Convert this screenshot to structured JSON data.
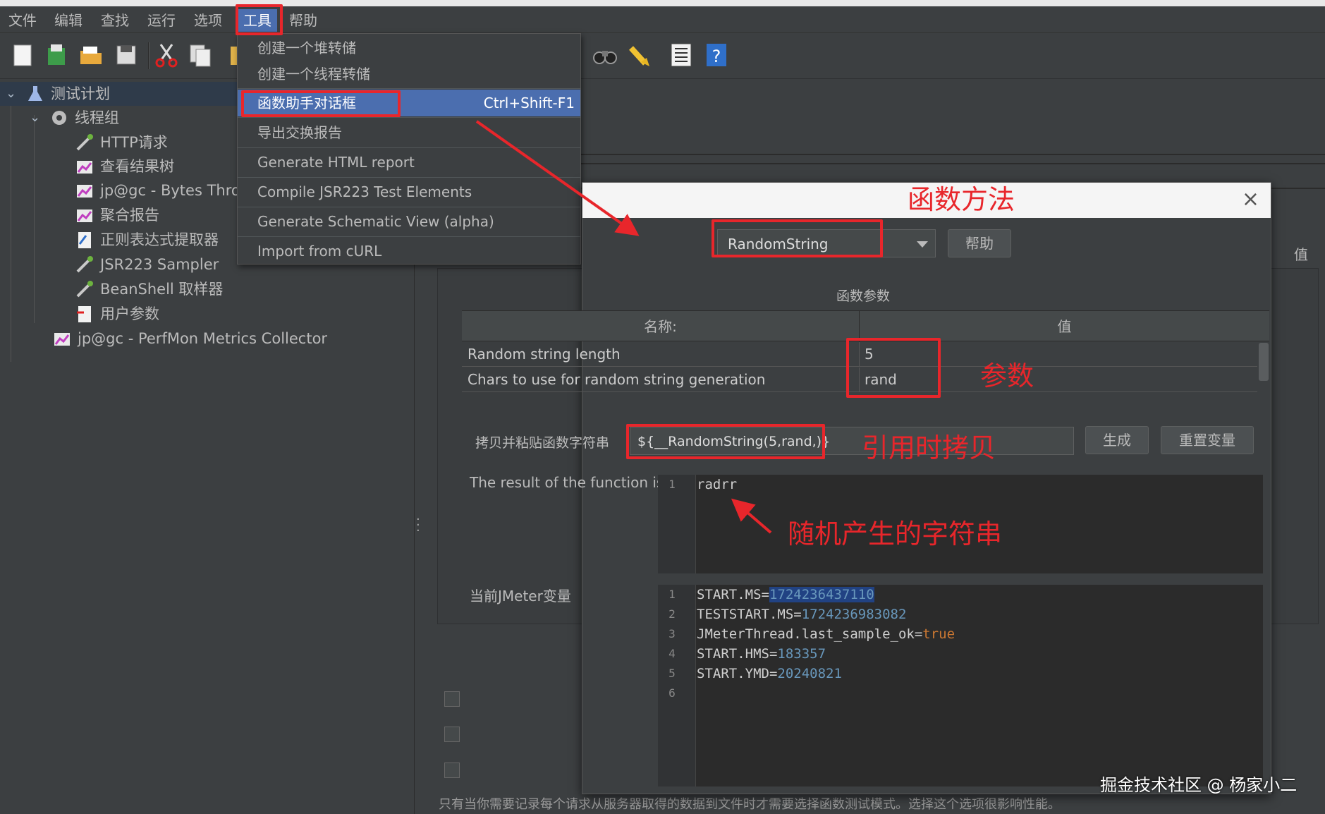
{
  "menubar": {
    "items": [
      "文件",
      "编辑",
      "查找",
      "运行",
      "选项",
      "工具",
      "帮助"
    ],
    "active_index": 5
  },
  "toolbar": {
    "icons": [
      "new-icon",
      "templates-icon",
      "open-icon",
      "save-icon",
      "cut-icon",
      "copy-icon",
      "paste-icon",
      "search-binoculars-icon",
      "clear-broom-icon",
      "function-helper-list-icon",
      "help-icon"
    ]
  },
  "tree": {
    "items": [
      {
        "label": "测试计划",
        "icon": "flask-icon",
        "level": 0,
        "expanded": true
      },
      {
        "label": "线程组",
        "icon": "gear-icon",
        "level": 1,
        "expanded": true
      },
      {
        "label": "HTTP请求",
        "icon": "pipette-icon",
        "level": 2
      },
      {
        "label": "查看结果树",
        "icon": "chart-icon",
        "level": 2
      },
      {
        "label": "jp@gc - Bytes Throu",
        "icon": "chart-icon",
        "level": 2
      },
      {
        "label": "聚合报告",
        "icon": "chart-icon",
        "level": 2
      },
      {
        "label": "正则表达式提取器",
        "icon": "document-icon",
        "level": 2
      },
      {
        "label": "JSR223 Sampler",
        "icon": "pipette-icon",
        "level": 2
      },
      {
        "label": "BeanShell 取样器",
        "icon": "pipette-icon",
        "level": 2
      },
      {
        "label": "用户参数",
        "icon": "document-icon",
        "level": 2
      },
      {
        "label": "jp@gc - PerfMon Metrics Collector",
        "icon": "chart-icon",
        "level": 1
      }
    ]
  },
  "dropdown": {
    "items": [
      {
        "label": "创建一个堆转储",
        "shortcut": ""
      },
      {
        "label": "创建一个线程转储",
        "shortcut": ""
      },
      {
        "label": "函数助手对话框",
        "shortcut": "Ctrl+Shift-F1",
        "highlighted": true
      },
      {
        "label": "导出交换报告",
        "shortcut": ""
      },
      {
        "label": "Generate HTML report",
        "shortcut": ""
      },
      {
        "label": "Compile JSR223 Test Elements",
        "shortcut": ""
      },
      {
        "label": "Generate Schematic View (alpha)",
        "shortcut": ""
      },
      {
        "label": "Import from cURL",
        "shortcut": ""
      }
    ]
  },
  "background": {
    "value_header": "值",
    "bottom_text": "只有当你需要记录每个请求从服务器取得的数据到文件时才需要选择函数测试模式。选择这个选项很影响性能。"
  },
  "dialog": {
    "function_select": "RandomString",
    "help_button": "帮助",
    "params_label": "函数参数",
    "table_headers": {
      "name": "名称:",
      "value": "值"
    },
    "params": [
      {
        "name": "Random string length",
        "value": "5"
      },
      {
        "name": "Chars to use for random string generation",
        "value": "rand"
      }
    ],
    "copy_label": "拷贝并粘贴函数字符串",
    "copy_value": "${__RandomString(5,rand,)}",
    "generate_button": "生成",
    "reset_button": "重置变量",
    "result_label": "The result of the function is",
    "result_lines": [
      "radrr"
    ],
    "vars_label": "当前JMeter变量",
    "vars_lines": [
      {
        "key": "START.MS=",
        "val": "1724236437110",
        "style": "sel-num"
      },
      {
        "key": "TESTSTART.MS=",
        "val": "1724236983082",
        "style": "num"
      },
      {
        "key": "JMeterThread.last_sample_ok=",
        "val": "true",
        "style": "kw"
      },
      {
        "key": "START.HMS=",
        "val": "183357",
        "style": "num"
      },
      {
        "key": "START.YMD=",
        "val": "20240821",
        "style": "num"
      },
      {
        "key": "",
        "val": "",
        "style": ""
      }
    ]
  },
  "annotations": {
    "function_method": "函数方法",
    "params": "参数",
    "copy_on_use": "引用时拷贝",
    "random_string": "随机产生的字符串"
  },
  "watermark": "掘金技术社区 @ 杨家小二",
  "colors": {
    "accent": "#4b6eaf",
    "annotation_red": "#e8262b",
    "background": "#3c3f41"
  }
}
